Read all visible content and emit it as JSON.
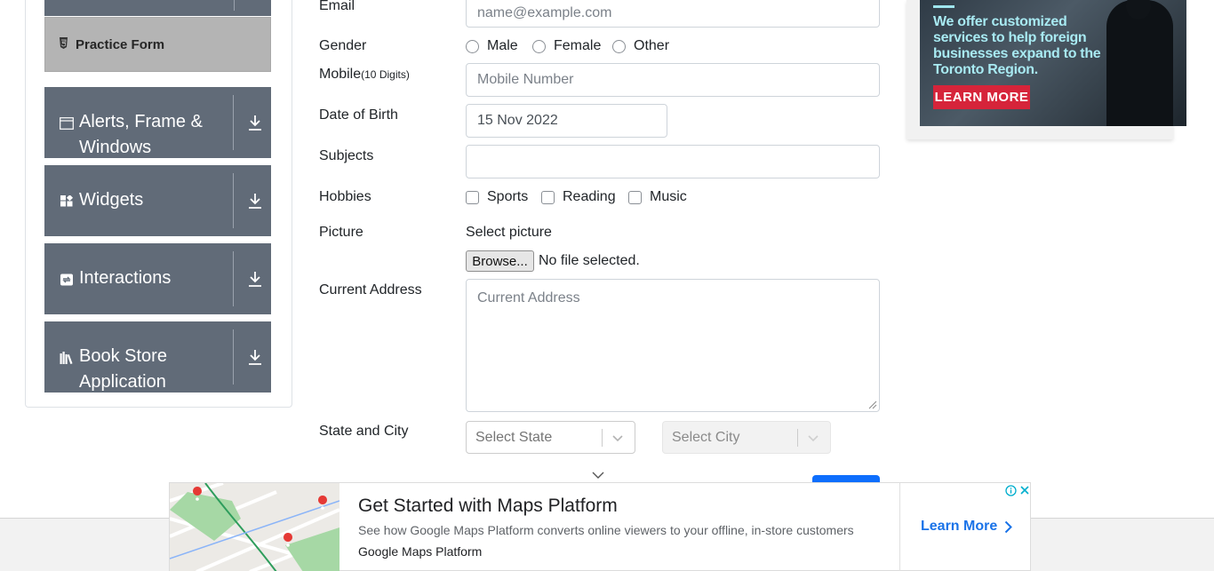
{
  "sidebar": {
    "practice_form_label": "Practice Form",
    "groups": [
      {
        "label_line1": "Alerts, Frame &",
        "label_line2": "Windows",
        "icon": "window-icon"
      },
      {
        "label_line1": "Widgets",
        "label_line2": "",
        "icon": "widgets-icon"
      },
      {
        "label_line1": "Interactions",
        "label_line2": "",
        "icon": "interactions-icon"
      },
      {
        "label_line1": "Book Store",
        "label_line2": "Application",
        "icon": "books-icon"
      }
    ]
  },
  "form": {
    "email_label": "Email",
    "email_placeholder": "name@example.com",
    "gender_label": "Gender",
    "gender_options": [
      "Male",
      "Female",
      "Other"
    ],
    "mobile_label": "Mobile",
    "mobile_hint": "(10 Digits)",
    "mobile_placeholder": "Mobile Number",
    "dob_label": "Date of Birth",
    "dob_value": "15 Nov 2022",
    "subjects_label": "Subjects",
    "hobbies_label": "Hobbies",
    "hobby_options": [
      "Sports",
      "Reading",
      "Music"
    ],
    "picture_label": "Picture",
    "select_picture": "Select picture",
    "browse_button": "Browse...",
    "file_status": "No file selected.",
    "address_label": "Current Address",
    "address_placeholder": "Current Address",
    "state_city_label": "State and City",
    "state_placeholder": "Select State",
    "city_placeholder": "Select City"
  },
  "ad_top": {
    "text": "We offer customized services to help foreign businesses expand to the Toronto Region.",
    "button": "LEARN MORE"
  },
  "ad_bottom": {
    "title": "Get Started with Maps Platform",
    "description": "See how Google Maps Platform converts online viewers to your offline, in-store customers",
    "brand": "Google Maps Platform",
    "cta": "Learn More"
  },
  "colors": {
    "group_bg": "#616b78",
    "practice_bg": "#b4b4b4",
    "accent_blue": "#1a73e8",
    "ad_red": "#d6243a"
  }
}
